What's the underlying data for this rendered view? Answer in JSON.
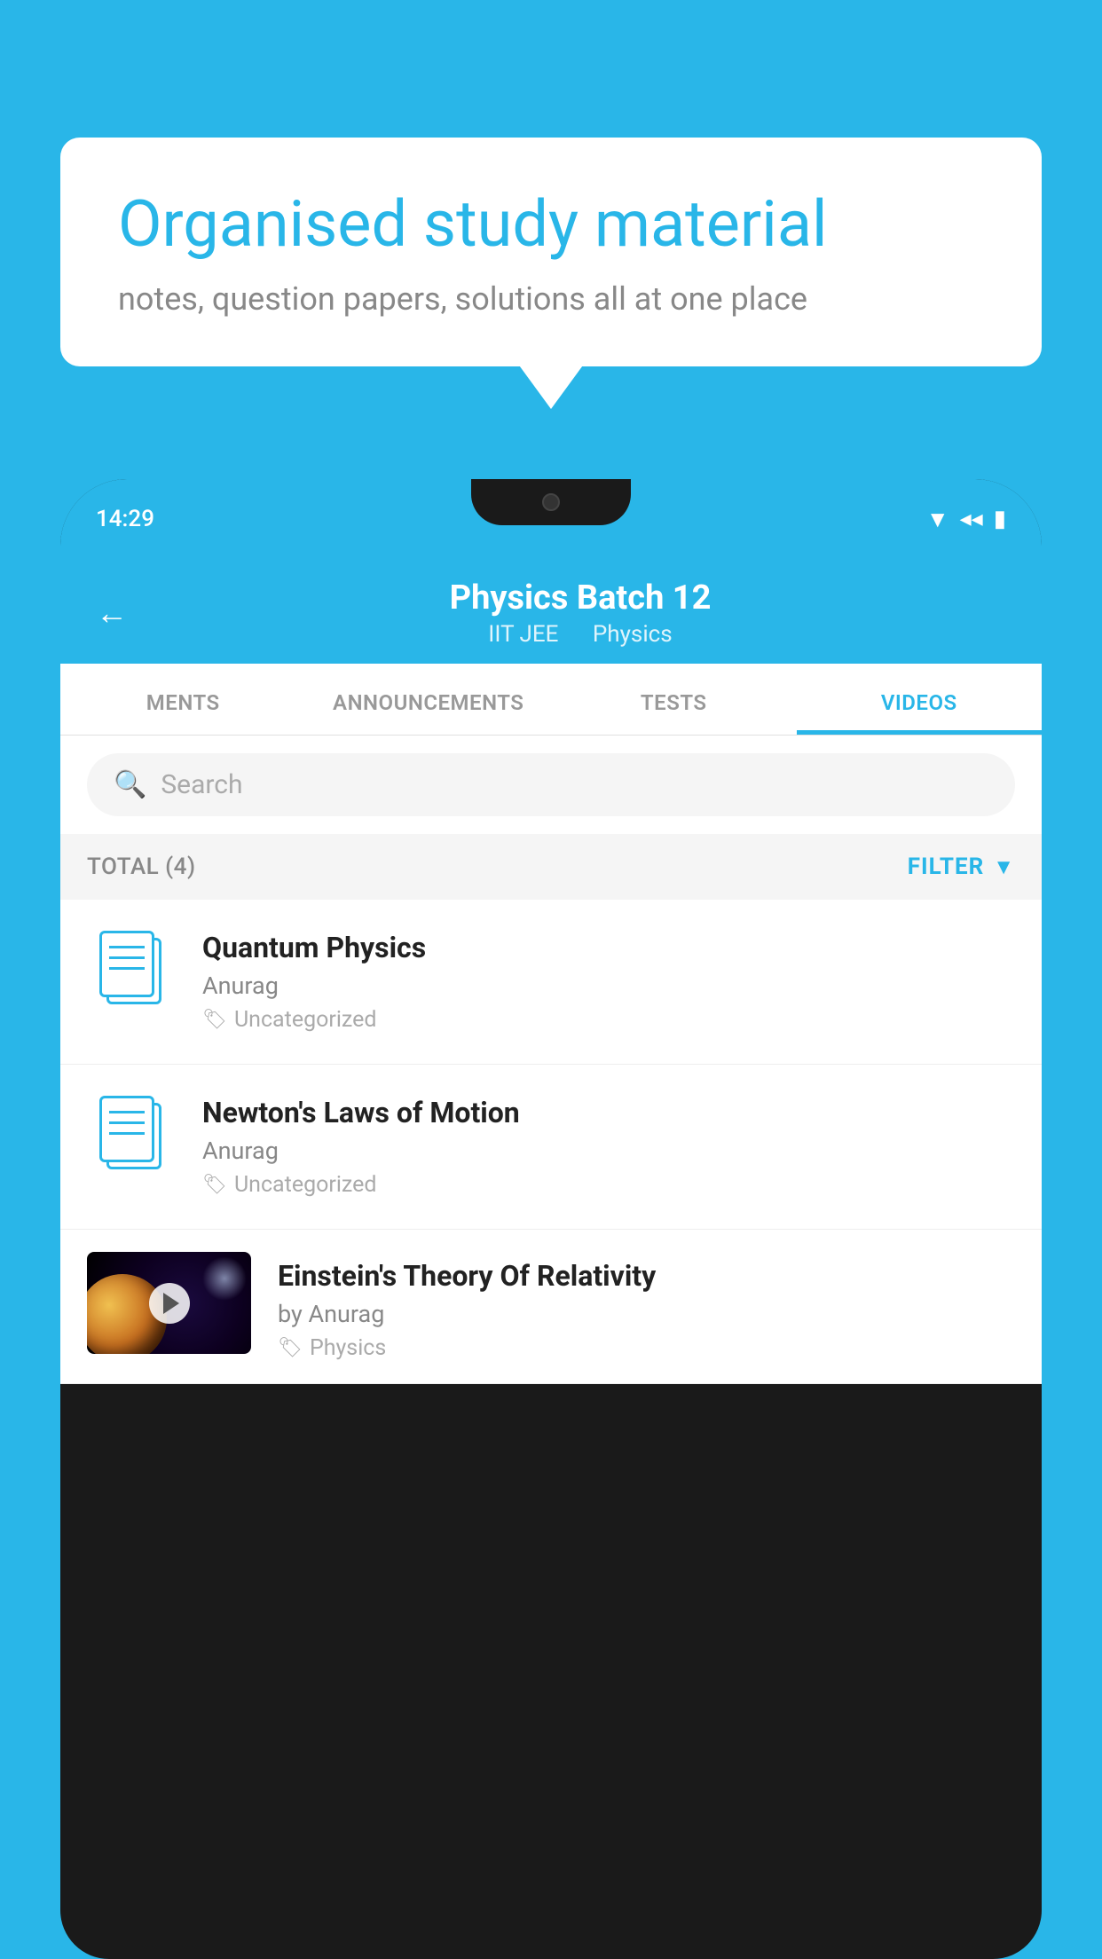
{
  "background_color": "#29b6e8",
  "bubble": {
    "title": "Organised study material",
    "subtitle": "notes, question papers, solutions all at one place"
  },
  "phone": {
    "status_time": "14:29",
    "header": {
      "title": "Physics Batch 12",
      "subtitle_part1": "IIT JEE",
      "subtitle_part2": "Physics",
      "back_label": "←"
    },
    "tabs": [
      {
        "label": "MENTS",
        "active": false
      },
      {
        "label": "ANNOUNCEMENTS",
        "active": false
      },
      {
        "label": "TESTS",
        "active": false
      },
      {
        "label": "VIDEOS",
        "active": true
      }
    ],
    "search": {
      "placeholder": "Search"
    },
    "filter": {
      "total_label": "TOTAL (4)",
      "filter_label": "FILTER"
    },
    "videos": [
      {
        "id": 1,
        "title": "Quantum Physics",
        "author": "Anurag",
        "tag": "Uncategorized",
        "has_thumbnail": false
      },
      {
        "id": 2,
        "title": "Newton's Laws of Motion",
        "author": "Anurag",
        "tag": "Uncategorized",
        "has_thumbnail": false
      },
      {
        "id": 3,
        "title": "Einstein's Theory Of Relativity",
        "author": "by Anurag",
        "tag": "Physics",
        "has_thumbnail": true
      }
    ]
  }
}
